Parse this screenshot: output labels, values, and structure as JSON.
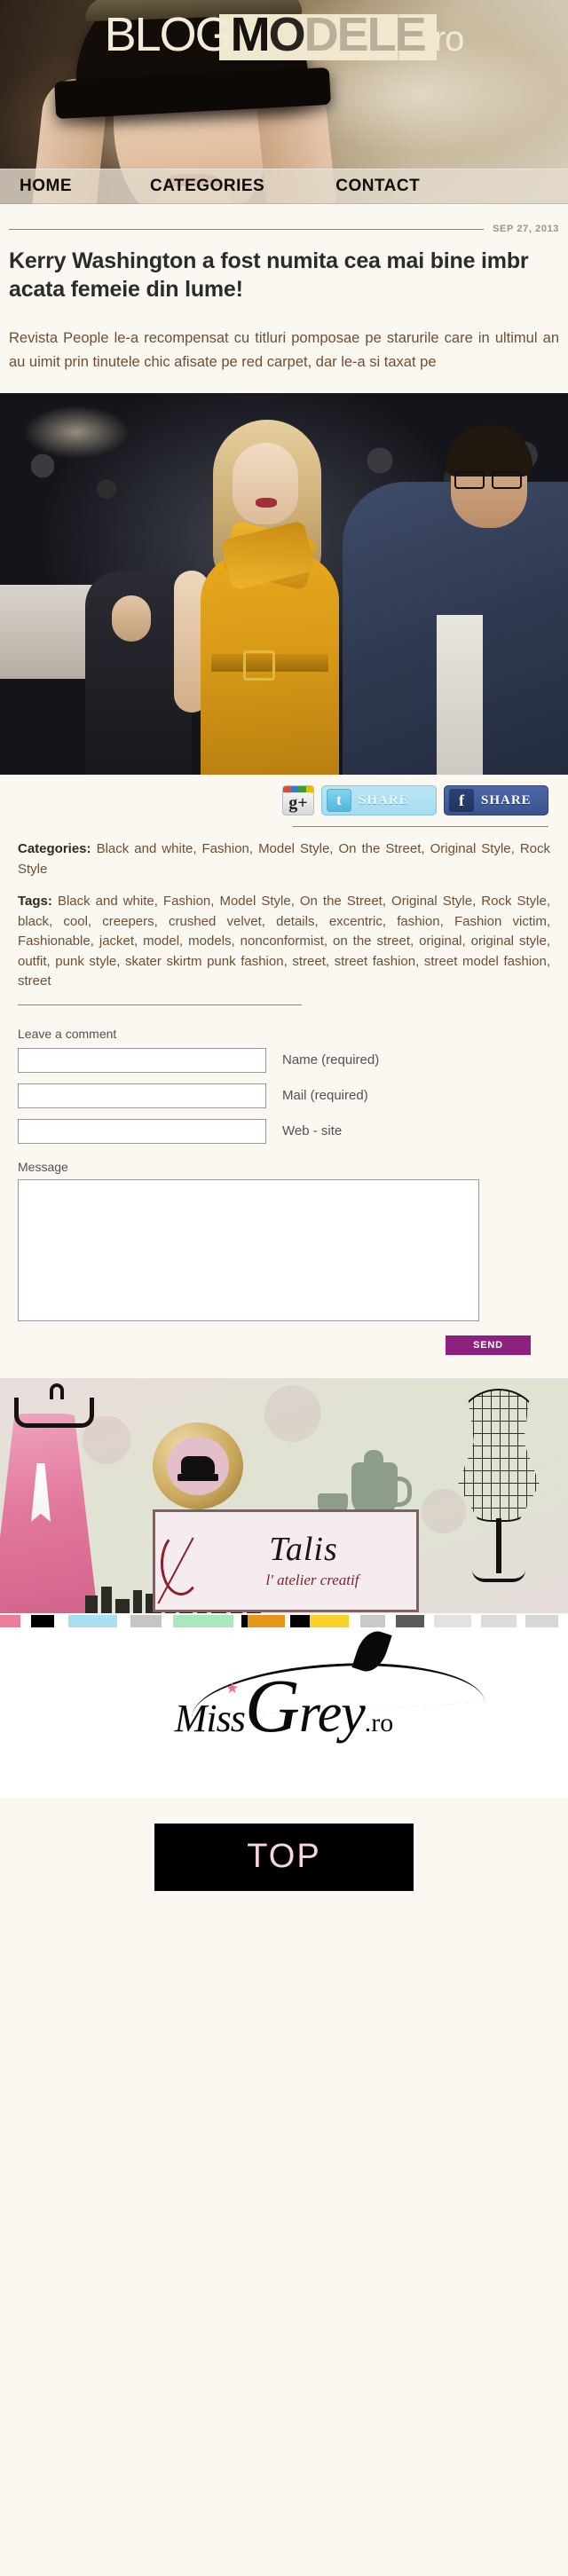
{
  "site": {
    "logo": {
      "part1": "BLOG",
      "part2": "M",
      "part3": "O",
      "part4": "DELE",
      "part5": ".ro"
    }
  },
  "nav": {
    "items": [
      {
        "label": "HOME"
      },
      {
        "label": "CATEGORIES"
      },
      {
        "label": "CONTACT"
      }
    ]
  },
  "post": {
    "date": "SEP 27, 2013",
    "title": "Kerry Washington a fost numita cea mai bine imbr acata femeie din lume!",
    "body": "Revista People le-a recompensat cu titluri pomposae pe starurile care in ultimul an au uimit prin tinutele chic afisate pe red carpet, dar le-a si taxat pe",
    "categories_label": "Categories:",
    "categories_value": "Black and white, Fashion, Model Style, On the Street, Original Style, Rock Style",
    "tags_label": "Tags:",
    "tags_value": "Black and white, Fashion, Model Style, On the Street, Original Style, Rock Style,  black, cool, creepers, crushed velvet, details, excentric, fashion, Fashion victim, Fashionable, jacket, model, models, nonconformist, on the street, original, original style, outfit, punk style, skater skirtm punk fashion, street, street fashion, street model fashion, street"
  },
  "share": {
    "gplus_label": "g+",
    "twitter_icon_label": "t",
    "twitter_label": "SHARE",
    "facebook_icon_label": "f",
    "facebook_label": "SHARE"
  },
  "comment_form": {
    "heading": "Leave a comment",
    "name_label": "Name (required)",
    "name_value": "",
    "name_placeholder": "",
    "mail_label": "Mail (required)",
    "mail_value": "",
    "mail_placeholder": "",
    "website_label": "Web - site",
    "website_value": "",
    "website_placeholder": "",
    "message_label": "Message",
    "message_value": "",
    "message_placeholder": "",
    "send_label": "SEND"
  },
  "banners": {
    "talis": {
      "name": "Talis",
      "tagline": "l' atelier creatif"
    },
    "missgrey": {
      "miss": "Miss",
      "g": "G",
      "rey": "rey",
      "tld": ".ro",
      "strip_colors": [
        "#ef7b9b",
        "#ffffff",
        "#000000",
        "#ffffff",
        "#a9def5",
        "#ffffff",
        "#c7c5c2",
        "#ffffff",
        "#a9e7bd",
        "#ffffff",
        "#000000",
        "#e89619",
        "#ffffff",
        "#000000",
        "#f8d12a",
        "#ffffff",
        "#c9c9c9",
        "#ffffff",
        "#5a5a5a",
        "#ffffff",
        "#e2e2e2",
        "#ffffff",
        "#dcdcdc",
        "#ffffff",
        "#d7d7d7",
        "#ffffff"
      ]
    }
  },
  "footer": {
    "top_label": "TOP"
  },
  "colors": {
    "page_bg": "#fbf8f2",
    "body_text": "#6e4f33",
    "accent_send": "#8e2180",
    "nav_bg": "#e4dbcd",
    "top_btn_text": "#f7d6df"
  }
}
